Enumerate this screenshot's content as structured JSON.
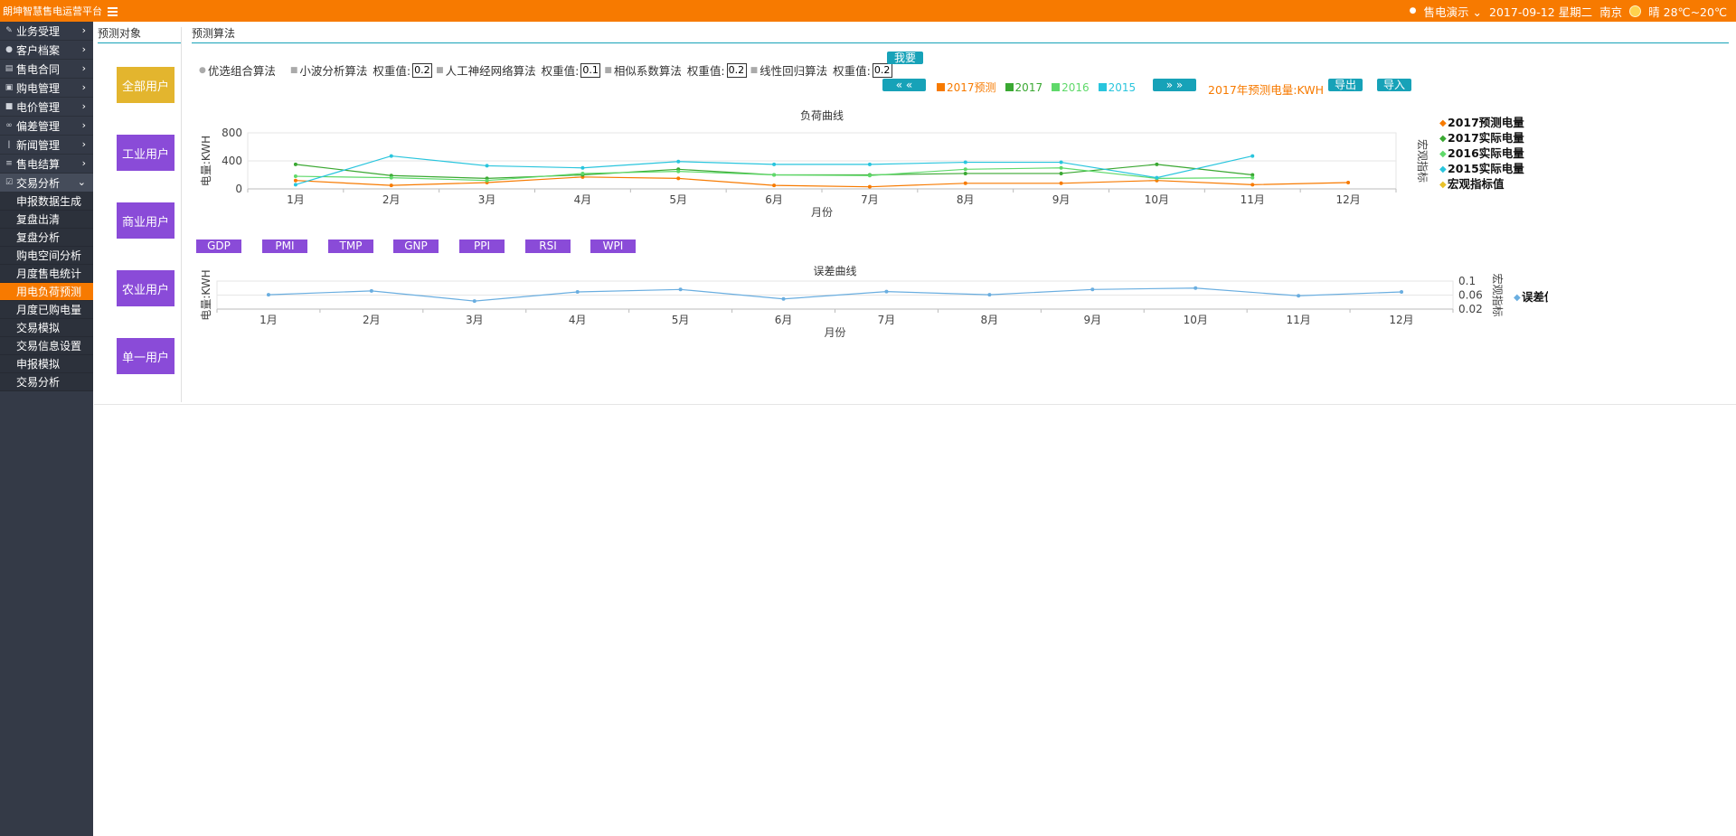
{
  "header": {
    "brand": "朗坤智慧售电运营平台",
    "user": "售电演示",
    "date": "2017-09-12 星期二",
    "city": "南京",
    "weather": "晴 28℃~20℃"
  },
  "sidebar": {
    "items": [
      {
        "label": "业务受理"
      },
      {
        "label": "客户档案"
      },
      {
        "label": "售电合同"
      },
      {
        "label": "购电管理"
      },
      {
        "label": "电价管理"
      },
      {
        "label": "偏差管理"
      },
      {
        "label": "新闻管理"
      },
      {
        "label": "售电结算"
      },
      {
        "label": "交易分析"
      }
    ],
    "sub_items": [
      {
        "label": "申报数据生成"
      },
      {
        "label": "复盘出清"
      },
      {
        "label": "复盘分析"
      },
      {
        "label": "购电空间分析"
      },
      {
        "label": "月度售电统计"
      },
      {
        "label": "用电负荷预测"
      },
      {
        "label": "月度已购电量"
      },
      {
        "label": "交易模拟"
      },
      {
        "label": "交易信息设置"
      },
      {
        "label": "申报模拟"
      },
      {
        "label": "交易分析"
      }
    ]
  },
  "left_panel": {
    "title": "预测对象",
    "buttons": [
      "全部用户",
      "工业用户",
      "商业用户",
      "农业用户",
      "单一用户"
    ],
    "colors": {
      "active": "#e3b52e",
      "normal": "#8a4bd8"
    }
  },
  "right_panel": {
    "title": "预测算法",
    "algorithms": [
      {
        "name": "优选组合算法"
      },
      {
        "name": "小波分析算法",
        "weight_label": "权重值:",
        "weight": "0.2"
      },
      {
        "name": "人工神经网络算法",
        "weight_label": "权重值:",
        "weight": "0.1"
      },
      {
        "name": "相似系数算法",
        "weight_label": "权重值:",
        "weight": "0.2"
      },
      {
        "name": "线性回归算法",
        "weight_label": "权重值:",
        "weight": "0.2"
      }
    ],
    "save_button": "我要",
    "prev_button": "« «",
    "next_button": "» »",
    "legend": [
      {
        "label": "2017预测",
        "color": "#f77a00"
      },
      {
        "label": "2017",
        "color": "#3aa832"
      },
      {
        "label": "2016",
        "color": "#5fd96a"
      },
      {
        "label": "2015",
        "color": "#29c5dd"
      }
    ],
    "forecast_label": "2017年预测电量:KWH",
    "export_button": "导出",
    "import_button": "导入",
    "metric_buttons": [
      "GDP",
      "PMI",
      "TMP",
      "GNP",
      "PPI",
      "RSI",
      "WPI"
    ]
  },
  "chart_data": [
    {
      "type": "line",
      "title": "负荷曲线",
      "xlabel": "月份",
      "ylabel": "电量:KWH",
      "y2label": "宏观指标",
      "categories": [
        "1月",
        "2月",
        "3月",
        "4月",
        "5月",
        "6月",
        "7月",
        "8月",
        "9月",
        "10月",
        "11月",
        "12月"
      ],
      "ylim": [
        0,
        800
      ],
      "yticks": [
        "0",
        "400",
        "800"
      ],
      "legend_position": "right",
      "series": [
        {
          "name": "2017预测电量",
          "color": "#f77a00",
          "values": [
            120,
            50,
            90,
            170,
            150,
            50,
            30,
            80,
            80,
            120,
            60,
            90
          ]
        },
        {
          "name": "2017实际电量",
          "color": "#3aa832",
          "values": [
            350,
            190,
            150,
            200,
            280,
            200,
            200,
            220,
            220,
            350,
            200,
            null
          ]
        },
        {
          "name": "2016实际电量",
          "color": "#5fd96a",
          "values": [
            180,
            160,
            120,
            220,
            250,
            200,
            190,
            280,
            300,
            150,
            160,
            null
          ]
        },
        {
          "name": "2015实际电量",
          "color": "#29c5dd",
          "values": [
            60,
            470,
            330,
            300,
            390,
            350,
            350,
            380,
            380,
            160,
            470,
            null
          ]
        },
        {
          "name": "宏观指标值",
          "color": "#e8c12a",
          "values": []
        }
      ]
    },
    {
      "type": "line",
      "title": "误差曲线",
      "xlabel": "月份",
      "ylabel": "电量:KWH",
      "y2label": "宏观指标",
      "categories": [
        "1月",
        "2月",
        "3月",
        "4月",
        "5月",
        "6月",
        "7月",
        "8月",
        "9月",
        "10月",
        "11月",
        "12月"
      ],
      "ylim": [
        0.02,
        0.1
      ],
      "yticks": [
        "0.02",
        "0.06",
        "0.1"
      ],
      "legend_position": "right",
      "series": [
        {
          "name": "误差值",
          "color": "#6aaee0",
          "values": [
            0.061,
            0.072,
            0.043,
            0.069,
            0.076,
            0.049,
            0.07,
            0.061,
            0.076,
            0.08,
            0.058,
            0.069
          ]
        }
      ]
    }
  ]
}
